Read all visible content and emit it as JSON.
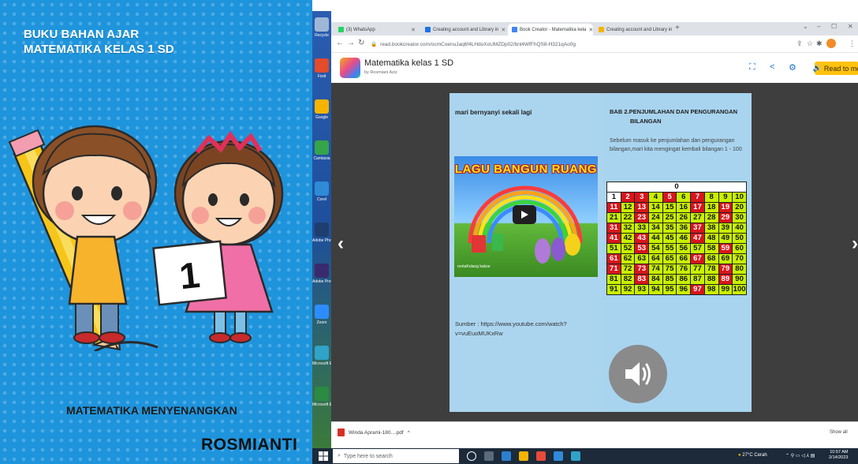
{
  "cover": {
    "title_line1": "BUKU BAHAN AJAR",
    "title_line2": "MATEMATIKA KELAS 1 SD",
    "card_number": "1",
    "subtitle": "MATEMATIKA MENYENANGKAN",
    "author": "ROSMIANTI"
  },
  "desktop": {
    "icons": [
      {
        "label": "Recycle",
        "icon": "recycle-bin-icon",
        "color": "#9fb6d6"
      },
      {
        "label": "Foxit",
        "icon": "app-icon",
        "color": "#e24b2b"
      },
      {
        "label": "Google",
        "icon": "app-icon",
        "color": "#f4b400"
      },
      {
        "label": "Camtasia",
        "icon": "app-icon",
        "color": "#35a44a"
      },
      {
        "label": "Corel",
        "icon": "app-icon",
        "color": "#2f8ad8"
      },
      {
        "label": "Adobe Photoshop",
        "icon": "photoshop-icon",
        "color": "#1d3e6e"
      },
      {
        "label": "Adobe Premiere",
        "icon": "premiere-icon",
        "color": "#3a2a6e"
      },
      {
        "label": "Zoom",
        "icon": "zoom-icon",
        "color": "#2d8cff"
      },
      {
        "label": "Microsoft Edge",
        "icon": "edge-icon",
        "color": "#2fa3c8"
      },
      {
        "label": "Microsoft Excel",
        "icon": "excel-icon",
        "color": "#2c8a43"
      }
    ]
  },
  "browser": {
    "tabs": [
      {
        "label": "(3) WhatsApp",
        "color": "#25d366"
      },
      {
        "label": "Creating account and Library in",
        "color": "#1a73e8"
      },
      {
        "label": "Book Creator - Matematika kela",
        "color": "#4285f4"
      },
      {
        "label": "Creating account and Library in",
        "color": "#f4b400"
      }
    ],
    "url": "read.bookcreator.com/ocmCoenuJaq6f4LHdoXoUMZDp02/bnl4WfFhQS8-H321qAo0g",
    "window_controls": [
      "⌄",
      "–",
      "☐",
      "✕"
    ]
  },
  "book_header": {
    "title": "Matematika kelas 1 SD",
    "author": "by Rosmiani Aziz",
    "read_to_me": "Read to me"
  },
  "page_left": {
    "heading": "mari bernyanyi sekali lagi",
    "video_title": "LAGU BANGUN RUANG",
    "video_caption": "rontaKolang kakoe",
    "source": "Sumber : https://www.youtube.com/watch?v=vuEuoMUKxRw"
  },
  "page_right": {
    "heading_line1": "BAB 2.PENJUMLAHAN DAN PENGURANGAN",
    "heading_line2": "BILANGAN",
    "intro": "Sebelum masuk ke penjumlahan dan pengurangan bilangan,mari kita mengingat kembali bilangan 1 - 100",
    "table_header": "0",
    "number_rows": [
      [
        "1",
        "2",
        "3",
        "4",
        "5",
        "6",
        "7",
        "8",
        "9",
        "10"
      ],
      [
        "11",
        "12",
        "13",
        "14",
        "15",
        "16",
        "17",
        "18",
        "19",
        "20"
      ],
      [
        "21",
        "22",
        "23",
        "24",
        "25",
        "26",
        "27",
        "28",
        "29",
        "30"
      ],
      [
        "31",
        "32",
        "33",
        "34",
        "35",
        "36",
        "37",
        "38",
        "39",
        "40"
      ],
      [
        "41",
        "42",
        "43",
        "44",
        "45",
        "46",
        "47",
        "48",
        "49",
        "50"
      ],
      [
        "51",
        "52",
        "53",
        "54",
        "55",
        "56",
        "57",
        "58",
        "59",
        "60"
      ],
      [
        "61",
        "62",
        "63",
        "64",
        "65",
        "66",
        "67",
        "68",
        "69",
        "70"
      ],
      [
        "71",
        "72",
        "73",
        "74",
        "75",
        "76",
        "77",
        "78",
        "79",
        "80"
      ],
      [
        "81",
        "82",
        "83",
        "84",
        "85",
        "86",
        "87",
        "88",
        "89",
        "90"
      ],
      [
        "91",
        "92",
        "93",
        "94",
        "95",
        "96",
        "97",
        "98",
        "99",
        "100"
      ]
    ],
    "red_numbers": [
      2,
      3,
      5,
      7,
      11,
      13,
      17,
      19,
      23,
      29,
      31,
      37,
      41,
      43,
      47,
      53,
      59,
      61,
      67,
      71,
      73,
      79,
      83,
      89,
      97
    ],
    "white_numbers": [
      1
    ]
  },
  "downloads": {
    "file": "Winda Aprami-180....pdf",
    "show_all": "Show all"
  },
  "taskbar": {
    "search_placeholder": "Type here to search",
    "weather": "27°C Cerah",
    "time": "10:57 AM",
    "date": "2/14/2023"
  }
}
